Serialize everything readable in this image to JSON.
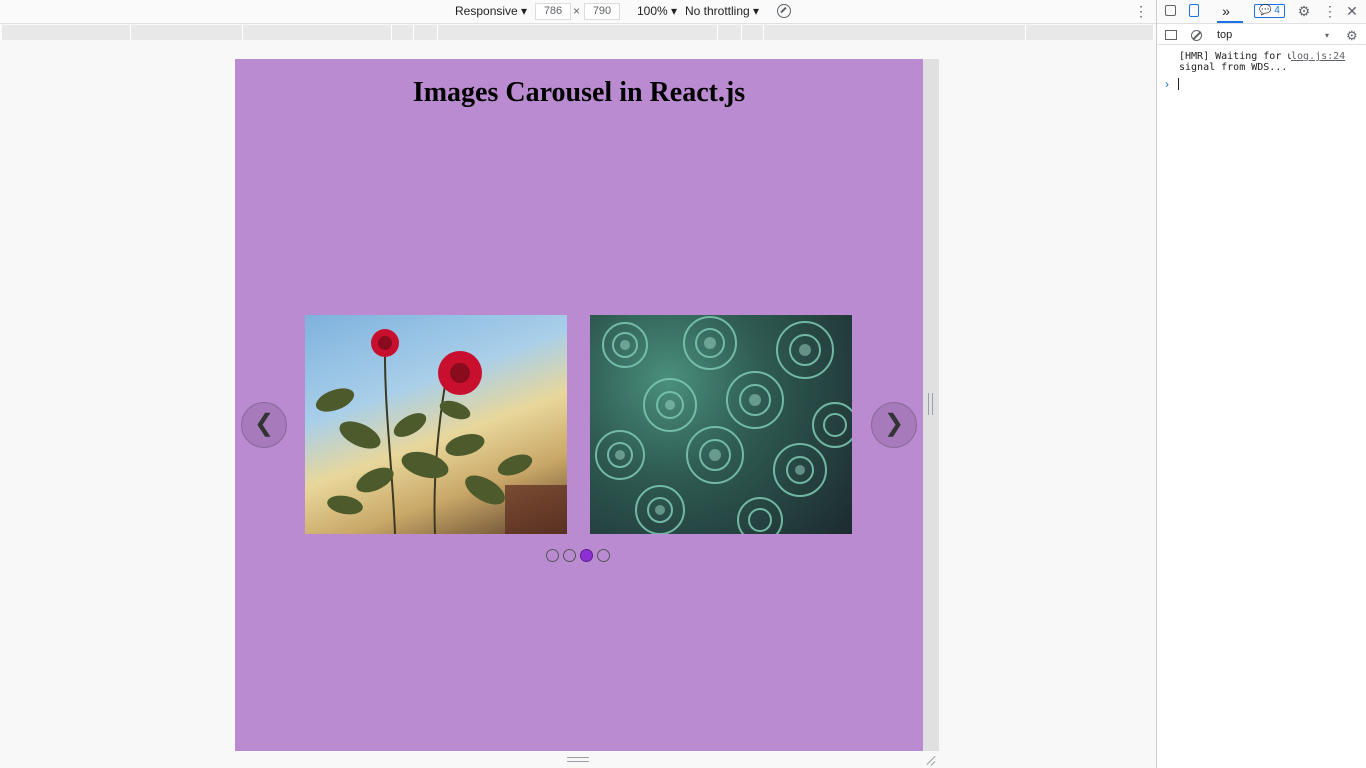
{
  "device_toolbar": {
    "device_mode": "Responsive ▾",
    "width_value": "786",
    "height_value": "790",
    "times_symbol": "×",
    "zoom": "100% ▾",
    "throttling": "No throttling ▾",
    "more_icon": "⋮"
  },
  "page": {
    "title": "Images Carousel in React.js",
    "prev_label": "❮",
    "next_label": "❯",
    "slides": [
      {
        "icon": "rose-image"
      },
      {
        "icon": "succulents-image"
      }
    ],
    "dots": [
      {
        "active": false
      },
      {
        "active": false
      },
      {
        "active": true
      },
      {
        "active": false
      }
    ],
    "colors": {
      "background": "#ba8bd1",
      "active_dot": "#8e2fd6"
    }
  },
  "devtools": {
    "more_tabs": "»",
    "issues_count": "4",
    "issues_badge_text": "💬 4",
    "settings_icon": "⚙",
    "kebab_icon": "⋮",
    "close_icon": "✕",
    "context": "top",
    "context_arrow": "▾",
    "settings_icon2": "⚙",
    "console_message": "[HMR] Waiting for update signal from WDS...",
    "console_source": "log.js:24",
    "prompt": "›"
  }
}
